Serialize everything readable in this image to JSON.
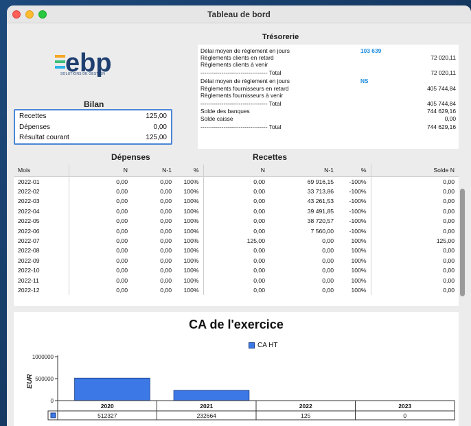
{
  "window": {
    "title": "Tableau de bord"
  },
  "logo": {
    "text": "ebp",
    "subtitle": "SOLUTIONS DE GESTION"
  },
  "bilan": {
    "title": "Bilan",
    "rows": [
      {
        "label": "Recettes",
        "value": "125,00"
      },
      {
        "label": "Dépenses",
        "value": "0,00"
      },
      {
        "label": "Résultat courant",
        "value": "125,00"
      }
    ]
  },
  "tresorerie": {
    "title": "Trésorerie",
    "lines": [
      {
        "label": "Délai moyen de règlement en jours",
        "mid": "103 639",
        "amount": ""
      },
      {
        "label": "Règlements clients en retard",
        "mid": "",
        "amount": "72 020,11"
      },
      {
        "label": "Règlements clients à venir",
        "mid": "",
        "amount": ""
      },
      {
        "label": "----------------------------------- Total",
        "mid": "",
        "amount": "72 020,11"
      },
      {
        "label": "Délai moyen de règlement en jours",
        "mid": "NS",
        "amount": ""
      },
      {
        "label": "Règlements fournisseurs en retard",
        "mid": "",
        "amount": "405 744,84"
      },
      {
        "label": "Règlements fournisseurs à venir",
        "mid": "",
        "amount": ""
      },
      {
        "label": "----------------------------------- Total",
        "mid": "",
        "amount": "405 744,84"
      },
      {
        "label": "Solde des banques",
        "mid": "",
        "amount": "744 629,16"
      },
      {
        "label": "Solde caisse",
        "mid": "",
        "amount": "0,00"
      },
      {
        "label": "----------------------------------- Total",
        "mid": "",
        "amount": "744 629,16"
      }
    ]
  },
  "table": {
    "group_depenses": "Dépenses",
    "group_recettes": "Recettes",
    "columns": [
      "Mois",
      "N",
      "N-1",
      "%",
      "N",
      "N-1",
      "%",
      "Solde N"
    ],
    "rows": [
      [
        "2022-01",
        "0,00",
        "0,00",
        "100%",
        "0,00",
        "69 916,15",
        "-100%",
        "0,00"
      ],
      [
        "2022-02",
        "0,00",
        "0,00",
        "100%",
        "0,00",
        "33 713,86",
        "-100%",
        "0,00"
      ],
      [
        "2022-03",
        "0,00",
        "0,00",
        "100%",
        "0,00",
        "43 261,53",
        "-100%",
        "0,00"
      ],
      [
        "2022-04",
        "0,00",
        "0,00",
        "100%",
        "0,00",
        "39 491,85",
        "-100%",
        "0,00"
      ],
      [
        "2022-05",
        "0,00",
        "0,00",
        "100%",
        "0,00",
        "38 720,57",
        "-100%",
        "0,00"
      ],
      [
        "2022-06",
        "0,00",
        "0,00",
        "100%",
        "0,00",
        "7 560,00",
        "-100%",
        "0,00"
      ],
      [
        "2022-07",
        "0,00",
        "0,00",
        "100%",
        "125,00",
        "0,00",
        "100%",
        "125,00"
      ],
      [
        "2022-08",
        "0,00",
        "0,00",
        "100%",
        "0,00",
        "0,00",
        "100%",
        "0,00"
      ],
      [
        "2022-09",
        "0,00",
        "0,00",
        "100%",
        "0,00",
        "0,00",
        "100%",
        "0,00"
      ],
      [
        "2022-10",
        "0,00",
        "0,00",
        "100%",
        "0,00",
        "0,00",
        "100%",
        "0,00"
      ],
      [
        "2022-11",
        "0,00",
        "0,00",
        "100%",
        "0,00",
        "0,00",
        "100%",
        "0,00"
      ],
      [
        "2022-12",
        "0,00",
        "0,00",
        "100%",
        "0,00",
        "0,00",
        "100%",
        "0,00"
      ]
    ]
  },
  "chart_data": {
    "type": "bar",
    "title": "CA de l'exercice",
    "ylabel": "EUR",
    "xlabel": "",
    "categories": [
      "2020",
      "2021",
      "2022",
      "2023"
    ],
    "series": [
      {
        "name": "CA HT",
        "values": [
          512327,
          232664,
          125,
          0
        ],
        "color": "#3c78e6"
      }
    ],
    "table_values": [
      "512327",
      "232664",
      "125",
      "0"
    ],
    "yticks": [
      "0",
      "500000",
      "1000000"
    ],
    "ylim": [
      0,
      1000000
    ],
    "legend": "top-center",
    "grid": false
  }
}
